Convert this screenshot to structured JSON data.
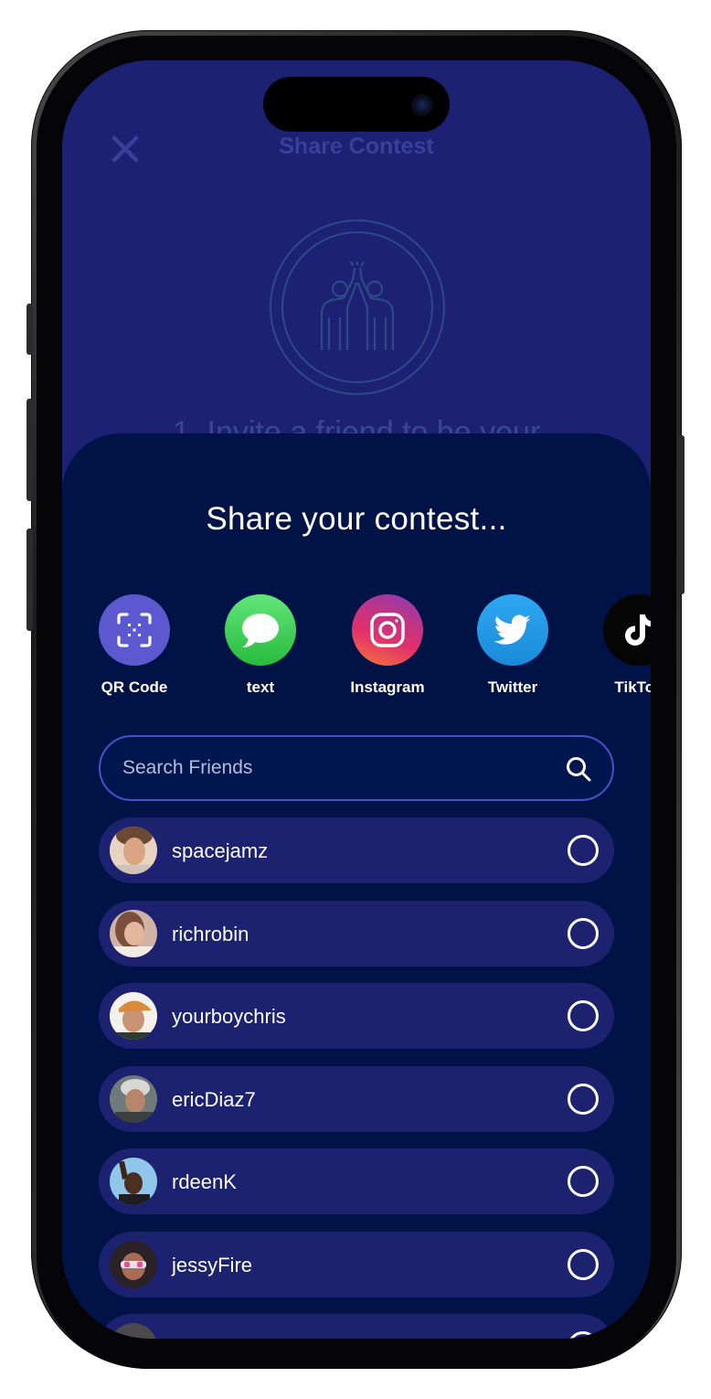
{
  "background": {
    "title": "Share Contest",
    "step_text": "1. Invite a friend to be your"
  },
  "sheet": {
    "title": "Share your contest..."
  },
  "share_options": [
    {
      "label": "QR Code",
      "icon": "qr-scan-icon",
      "color": "#5c58cf"
    },
    {
      "label": "text",
      "icon": "message-bubble-icon",
      "color": "#34c759"
    },
    {
      "label": "Instagram",
      "icon": "instagram-icon",
      "color": "#e1306c"
    },
    {
      "label": "Twitter",
      "icon": "twitter-bird-icon",
      "color": "#1d9bf0"
    },
    {
      "label": "TikTok",
      "icon": "tiktok-icon",
      "color": "#000000"
    }
  ],
  "search": {
    "placeholder": "Search Friends",
    "value": ""
  },
  "friends": [
    {
      "name": "spacejamz",
      "selected": false
    },
    {
      "name": "richrobin",
      "selected": false
    },
    {
      "name": "yourboychris",
      "selected": false
    },
    {
      "name": "ericDiaz7",
      "selected": false
    },
    {
      "name": "rdeenK",
      "selected": false
    },
    {
      "name": "jessyFire",
      "selected": false
    },
    {
      "name": "",
      "selected": false
    }
  ],
  "colors": {
    "page_bg": "#1c2174",
    "sheet_bg": "#001347",
    "row_bg": "#1c2270",
    "search_border": "#4751c8"
  }
}
